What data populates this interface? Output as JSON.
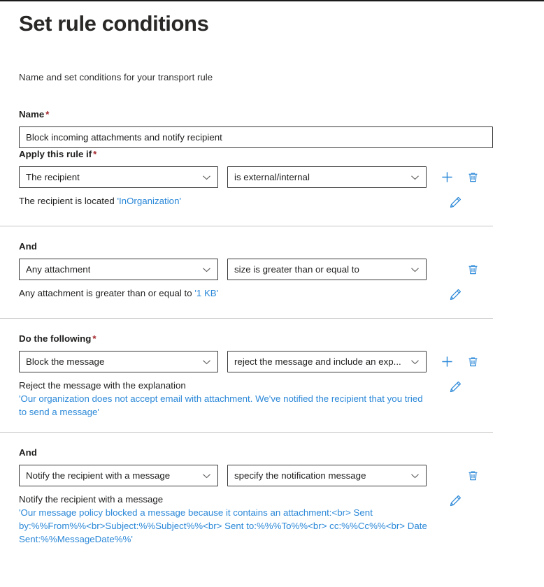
{
  "page": {
    "title": "Set rule conditions",
    "subtitle": "Name and set conditions for your transport rule"
  },
  "colors": {
    "accent_blue": "#2b88d8",
    "required_red": "#a4262c",
    "border_dark": "#3b3a39",
    "divider": "#c8c6c4",
    "text": "#201f1e"
  },
  "name_field": {
    "label": "Name",
    "required_marker": "*",
    "value": "Block incoming attachments and notify recipient",
    "placeholder": ""
  },
  "sections": [
    {
      "label": "Apply this rule if",
      "required_marker": "*",
      "condition_select": "The recipient",
      "operator_select": "is external/internal",
      "has_add": true,
      "has_delete": true,
      "description_prefix": "The recipient is located ",
      "description_value": "'InOrganization'",
      "description_second_line": "",
      "divider_above": false
    },
    {
      "label": "And",
      "required_marker": "",
      "condition_select": "Any attachment",
      "operator_select": "size is greater than or equal to",
      "has_add": false,
      "has_delete": true,
      "description_prefix": "Any attachment is greater than or equal to ",
      "description_value": "'1 KB'",
      "description_second_line": "",
      "divider_above": true
    },
    {
      "label": "Do the following",
      "required_marker": "*",
      "condition_select": "Block the message",
      "operator_select": "reject the message and include an exp...",
      "has_add": true,
      "has_delete": true,
      "description_prefix": "Reject the message with the explanation",
      "description_value": "",
      "description_second_line": "'Our organization does not accept email with attachment. We've notified the recipient that you tried to send a message'",
      "divider_above": true
    },
    {
      "label": "And",
      "required_marker": "",
      "condition_select": "Notify the recipient with a message",
      "operator_select": "specify the notification message",
      "has_add": false,
      "has_delete": true,
      "description_prefix": "Notify the recipient with a message",
      "description_value": "",
      "description_second_line": "'Our message policy blocked a message because it contains an attachment:<br> Sent by:%%From%%<br>Subject:%%Subject%%<br> Sent to:%%%To%%<br> cc:%%Cc%%<br> Date Sent:%%MessageDate%%'",
      "divider_above": true
    }
  ],
  "icons": {
    "add": "plus-icon",
    "delete": "trash-icon",
    "edit": "pencil-icon",
    "dropdown": "chevron-down-icon"
  }
}
